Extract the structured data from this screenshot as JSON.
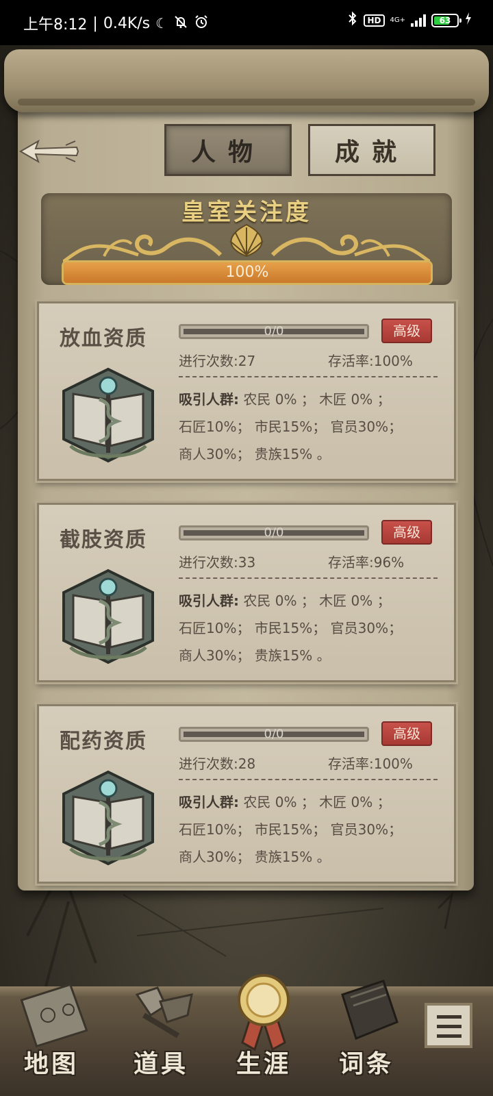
{
  "status_bar": {
    "time": "上午8:12",
    "speed": "0.4K/s",
    "hd": "HD",
    "network": "4G+",
    "battery": "63"
  },
  "tabs": [
    {
      "label": "人物",
      "active": true
    },
    {
      "label": "成就",
      "active": false
    }
  ],
  "royal": {
    "title": "皇室关注度",
    "progress_label": "100%",
    "progress_fraction": 1.0
  },
  "cards": [
    {
      "title": "放血资质",
      "progress": "0/0",
      "badge": "高级",
      "count_label": "进行次数:27",
      "survival_label": "存活率:100%",
      "line1_prefix": "吸引人群:",
      "line1": "农民 0% ； 木匠 0% ；",
      "line2": "石匠10%； 市民15%； 官员30%；",
      "line3": "商人30%； 贵族15% 。"
    },
    {
      "title": "截肢资质",
      "progress": "0/0",
      "badge": "高级",
      "count_label": "进行次数:33",
      "survival_label": "存活率:96%",
      "line1_prefix": "吸引人群:",
      "line1": "农民 0% ； 木匠 0% ；",
      "line2": "石匠10%； 市民15%； 官员30%；",
      "line3": "商人30%； 贵族15% 。"
    },
    {
      "title": "配药资质",
      "progress": "0/0",
      "badge": "高级",
      "count_label": "进行次数:28",
      "survival_label": "存活率:100%",
      "line1_prefix": "吸引人群:",
      "line1": "农民 0% ； 木匠 0% ；",
      "line2": "石匠10%； 市民15%； 官员30%；",
      "line3": "商人30%； 贵族15% 。"
    }
  ],
  "nav": [
    {
      "label": "地图",
      "icon": "map-icon"
    },
    {
      "label": "道具",
      "icon": "tools-icon"
    },
    {
      "label": "生涯",
      "icon": "medal-icon"
    },
    {
      "label": "词条",
      "icon": "book-icon"
    }
  ],
  "menu_icon": "list-icon",
  "colors": {
    "accent_gold": "#e9cf82",
    "progress_orange": "#d98a36",
    "badge_red": "#b8453f",
    "paper": "#c3b99f"
  }
}
